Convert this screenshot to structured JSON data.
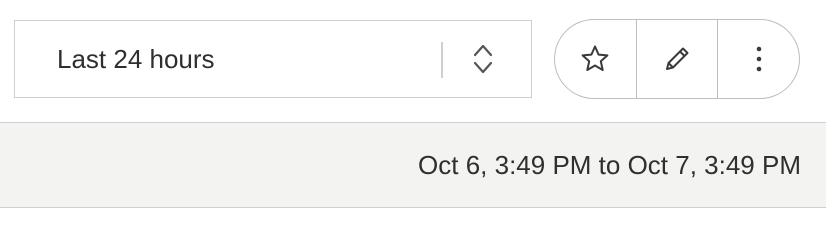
{
  "time_range": {
    "selected": "Last 24 hours",
    "arrows_icon": "chevron-up-down-icon"
  },
  "actions": [
    {
      "name": "favorite",
      "icon": "star-icon"
    },
    {
      "name": "edit",
      "icon": "pencil-icon"
    },
    {
      "name": "more",
      "icon": "vertical-ellipsis-icon"
    }
  ],
  "range_summary": {
    "text": "Oct 6, 3:49 PM to Oct 7, 3:49 PM"
  },
  "colors": {
    "border": "#cfcfcf",
    "footer_background": "#f3f3f1",
    "text": "#2f2f2f"
  }
}
